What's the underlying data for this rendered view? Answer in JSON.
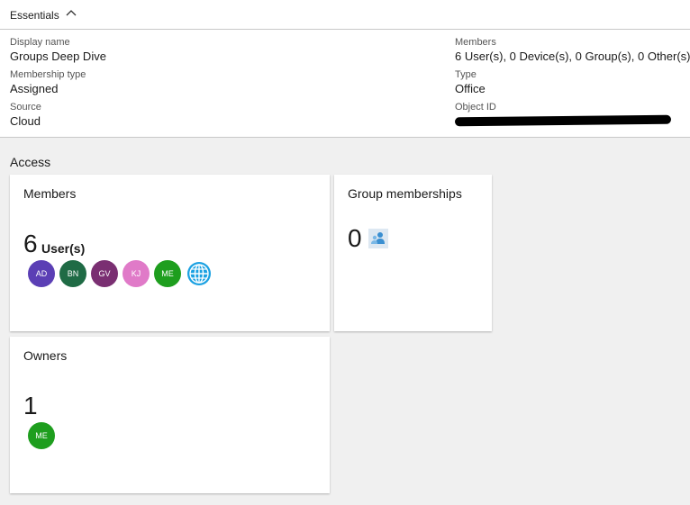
{
  "essentials": {
    "title": "Essentials",
    "left": [
      {
        "label": "Display name",
        "value": "Groups Deep Dive"
      },
      {
        "label": "Membership type",
        "value": "Assigned"
      },
      {
        "label": "Source",
        "value": "Cloud"
      }
    ],
    "right": [
      {
        "label": "Members",
        "value": "6 User(s), 0 Device(s), 0 Group(s), 0 Other(s)"
      },
      {
        "label": "Type",
        "value": "Office"
      },
      {
        "label": "Object ID",
        "value": ""
      }
    ]
  },
  "access": {
    "heading": "Access",
    "members": {
      "title": "Members",
      "count": "6",
      "suffix": "User(s)",
      "avatars": [
        {
          "initials": "AD",
          "color": "#5b3fb5"
        },
        {
          "initials": "BN",
          "color": "#1f6b45"
        },
        {
          "initials": "GV",
          "color": "#7a2f72"
        },
        {
          "initials": "KJ",
          "color": "#e07ac8"
        },
        {
          "initials": "ME",
          "color": "#1e9e1e"
        }
      ],
      "globe_icon": "globe-icon",
      "globe_color": "#1ba1e2"
    },
    "group_memberships": {
      "title": "Group memberships",
      "count": "0",
      "icon": "group-icon"
    },
    "owners": {
      "title": "Owners",
      "count": "1",
      "avatars": [
        {
          "initials": "ME",
          "color": "#1e9e1e"
        }
      ]
    }
  }
}
